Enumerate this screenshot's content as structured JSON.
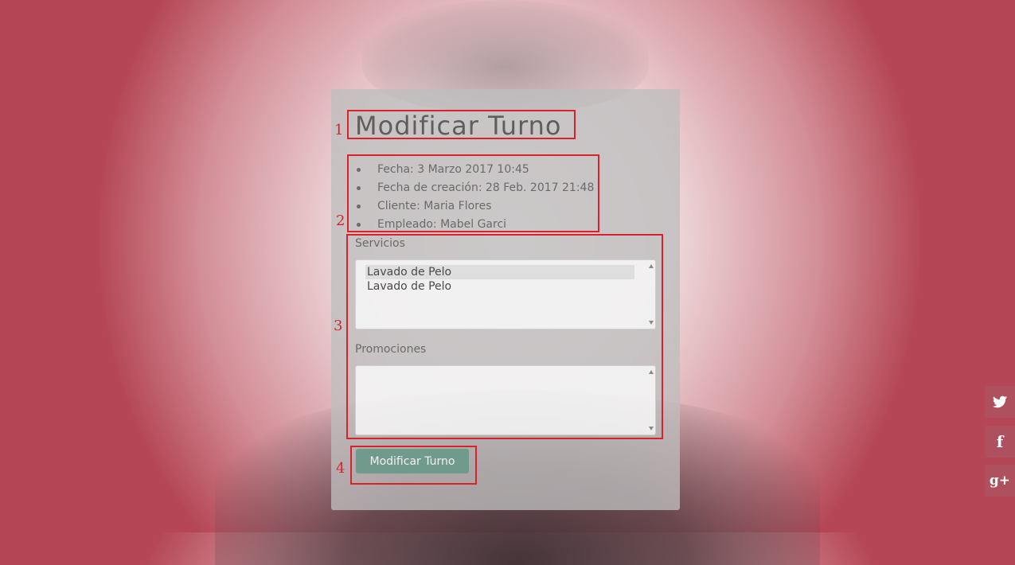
{
  "form": {
    "title": "Modificar Turno",
    "details": [
      "Fecha: 3 Marzo 2017 10:45",
      "Fecha de creación: 28 Feb. 2017 21:48",
      "Cliente: Maria Flores",
      "Empleado: Mabel Garci"
    ],
    "servicios": {
      "label": "Servicios",
      "options": [
        "Lavado de Pelo",
        "Lavado de Pelo"
      ],
      "selected_index": 0
    },
    "promociones": {
      "label": "Promociones",
      "options": []
    },
    "submit_label": "Modificar Turno"
  },
  "annotations": [
    "1",
    "2",
    "3",
    "4"
  ],
  "social": {
    "twitter": "twitter-icon",
    "facebook": "facebook-icon",
    "googleplus": "google-plus-icon",
    "facebook_glyph": "f",
    "googleplus_glyph": "g+"
  },
  "colors": {
    "annotation": "#d9222c",
    "button": "#6f9a8c",
    "panel": "#bebebe"
  }
}
